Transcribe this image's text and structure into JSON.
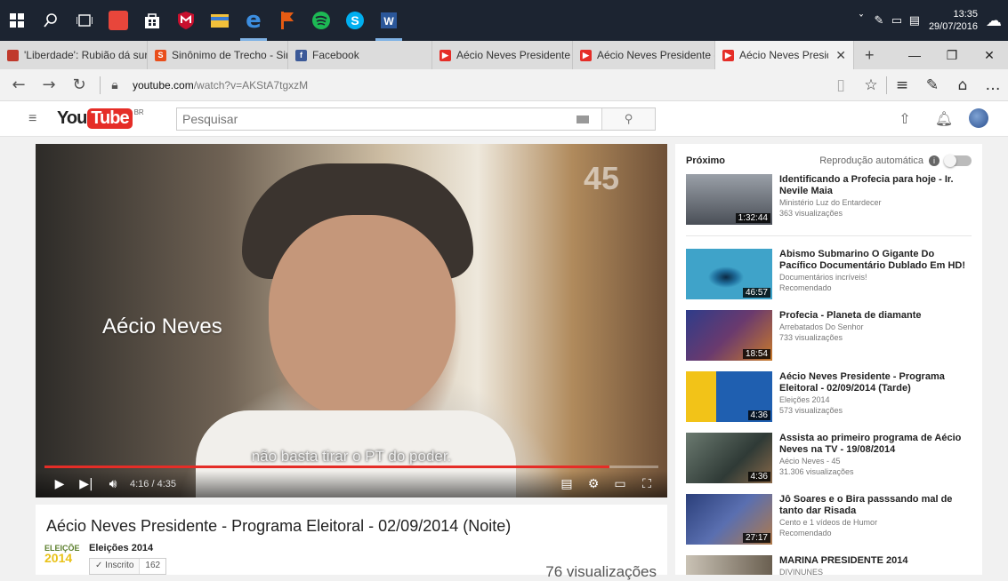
{
  "taskbar": {
    "apps": [
      {
        "icon": "windows-start-icon",
        "color": "#ffffff"
      },
      {
        "icon": "search-icon",
        "color": "#ffffff"
      },
      {
        "icon": "task-view-icon",
        "color": "#ffffff"
      },
      {
        "icon": "mail-icon",
        "color": "#e8463b"
      },
      {
        "icon": "store-icon",
        "color": "#ffffff"
      },
      {
        "icon": "mcafee-icon",
        "color": "#c8102e"
      },
      {
        "icon": "file-explorer-icon",
        "color": "#f3c13a"
      },
      {
        "icon": "edge-icon",
        "color": "#3277bc"
      },
      {
        "icon": "flag-app-icon",
        "color": "#e55b13"
      },
      {
        "icon": "spotify-icon",
        "color": "#1db954"
      },
      {
        "icon": "skype-icon",
        "color": "#00aff0"
      },
      {
        "icon": "word-icon",
        "color": "#2b579a"
      }
    ],
    "time": "13:35",
    "date": "29/07/2016"
  },
  "tabs": [
    {
      "label": "'Liberdade': Rubião dá sur",
      "fav_color": "#c0392b",
      "fav_text": ""
    },
    {
      "label": "Sinônimo de Trecho - Sinô",
      "fav_color": "#e94e1b",
      "fav_text": "S"
    },
    {
      "label": "Facebook",
      "fav_color": "#3b5998",
      "fav_text": "f"
    },
    {
      "label": "Aécio Neves Presidente -",
      "fav_color": "#e52d27",
      "fav_text": "▶"
    },
    {
      "label": "Aécio Neves Presidente - I",
      "fav_color": "#e52d27",
      "fav_text": "▶"
    },
    {
      "label": "Aécio Neves Presidenț",
      "fav_color": "#e52d27",
      "fav_text": "▶",
      "active": true
    }
  ],
  "address": {
    "host": "youtube.com",
    "path": "/watch?v=AKStA7tgxzM"
  },
  "youtube": {
    "logo_you": "You",
    "logo_tube": "Tube",
    "logo_region": "BR",
    "search_placeholder": "Pesquisar"
  },
  "player": {
    "channel_number": "45",
    "name_overlay": "Aécio Neves",
    "subtitle": "não basta tirar o PT do poder.",
    "current_time": "4:16",
    "duration": "4:35",
    "time_display": "4:16 / 4:35",
    "progress_fraction": 0.92
  },
  "video": {
    "title": "Aécio Neves Presidente - Programa Eleitoral - 02/09/2014 (Noite)",
    "channel": "Eleições 2014",
    "channel_logo_text": "ELEIÇÕE",
    "channel_logo_year": "2014",
    "subscribe_label": "Inscrito",
    "subscriber_count": "162",
    "views": "76 visualizações"
  },
  "sidebar": {
    "next_label": "Próximo",
    "autoplay_label": "Reprodução automática",
    "items": [
      {
        "title": "Identificando a Profecia para hoje - Ir. Nevile Maia",
        "channel": "Ministério Luz do Entardecer",
        "meta": "363 visualizações",
        "duration": "1:32:44",
        "thumb": "#6a6f78"
      },
      {
        "title": "Abismo Submarino O Gigante Do Pacífico Documentário Dublado Em HD!",
        "channel": "Documentários incríveis!",
        "meta": "Recomendado",
        "duration": "46:57",
        "thumb": "#1f6e9c"
      },
      {
        "title": "Profecia - Planeta de diamante",
        "channel": "Arrebatados Do Senhor",
        "meta": "733 visualizações",
        "duration": "18:54",
        "thumb": "#4a3a6e"
      },
      {
        "title": "Aécio Neves Presidente - Programa Eleitoral - 02/09/2014 (Tarde)",
        "channel": "Eleições 2014",
        "meta": "573 visualizações",
        "duration": "4:36",
        "thumb": "#1f5fb0"
      },
      {
        "title": "Assista ao primeiro programa de Aécio Neves na TV - 19/08/2014",
        "channel": "Aécio Neves - 45",
        "meta": "31.306 visualizações",
        "duration": "4:36",
        "thumb": "#3d4a44"
      },
      {
        "title": "Jô Soares e o Bira passsando mal de tanto dar Risada",
        "channel": "Cento e 1 vídeos de Humor",
        "meta": "Recomendado",
        "duration": "27:17",
        "thumb": "#3a4f8a"
      },
      {
        "title": "MARINA PRESIDENTE 2014",
        "channel": "DIVINUNES",
        "meta": "",
        "duration": "",
        "thumb": "#8a8070"
      }
    ]
  }
}
